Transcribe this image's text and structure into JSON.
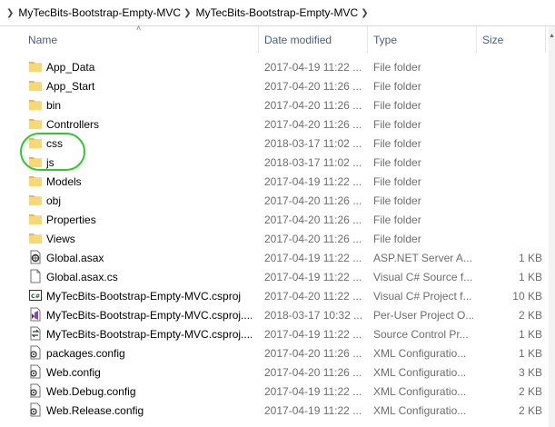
{
  "breadcrumb": [
    "MyTecBits-Bootstrap-Empty-MVC",
    "MyTecBits-Bootstrap-Empty-MVC"
  ],
  "columns": {
    "name": "Name",
    "date": "Date modified",
    "type": "Type",
    "size": "Size"
  },
  "rows": [
    {
      "name": "App_Data",
      "date": "2017-04-19 11:22 ...",
      "type": "File folder",
      "size": "",
      "icon": "folder-icon"
    },
    {
      "name": "App_Start",
      "date": "2017-04-20 11:26 ...",
      "type": "File folder",
      "size": "",
      "icon": "folder-icon"
    },
    {
      "name": "bin",
      "date": "2017-04-20 11:26 ...",
      "type": "File folder",
      "size": "",
      "icon": "folder-icon"
    },
    {
      "name": "Controllers",
      "date": "2017-04-20 11:26 ...",
      "type": "File folder",
      "size": "",
      "icon": "folder-icon"
    },
    {
      "name": "css",
      "date": "2018-03-17 11:02 ...",
      "type": "File folder",
      "size": "",
      "icon": "folder-icon"
    },
    {
      "name": "js",
      "date": "2018-03-17 11:02 ...",
      "type": "File folder",
      "size": "",
      "icon": "folder-icon"
    },
    {
      "name": "Models",
      "date": "2017-04-19 11:22 ...",
      "type": "File folder",
      "size": "",
      "icon": "folder-icon"
    },
    {
      "name": "obj",
      "date": "2017-04-20 11:26 ...",
      "type": "File folder",
      "size": "",
      "icon": "folder-icon"
    },
    {
      "name": "Properties",
      "date": "2017-04-20 11:26 ...",
      "type": "File folder",
      "size": "",
      "icon": "folder-icon"
    },
    {
      "name": "Views",
      "date": "2017-04-20 11:26 ...",
      "type": "File folder",
      "size": "",
      "icon": "folder-icon"
    },
    {
      "name": "Global.asax",
      "date": "2017-04-19 11:22 ...",
      "type": "ASP.NET Server A...",
      "size": "1 KB",
      "icon": "asax-file-icon"
    },
    {
      "name": "Global.asax.cs",
      "date": "2017-04-19 11:22 ...",
      "type": "Visual C# Source f...",
      "size": "1 KB",
      "icon": "file-icon"
    },
    {
      "name": "MyTecBits-Bootstrap-Empty-MVC.csproj",
      "date": "2017-04-20 11:22 ...",
      "type": "Visual C# Project f...",
      "size": "10 KB",
      "icon": "csproj-file-icon"
    },
    {
      "name": "MyTecBits-Bootstrap-Empty-MVC.csproj....",
      "date": "2018-03-17 10:32 ...",
      "type": "Per-User Project O...",
      "size": "2 KB",
      "icon": "vs-file-icon"
    },
    {
      "name": "MyTecBits-Bootstrap-Empty-MVC.csproj....",
      "date": "2017-04-19 11:22 ...",
      "type": "Source Control Pr...",
      "size": "1 KB",
      "icon": "source-control-file-icon"
    },
    {
      "name": "packages.config",
      "date": "2017-04-20 11:26 ...",
      "type": "XML Configuratio...",
      "size": "1 KB",
      "icon": "config-file-icon"
    },
    {
      "name": "Web.config",
      "date": "2017-04-20 11:26 ...",
      "type": "XML Configuratio...",
      "size": "3 KB",
      "icon": "config-file-icon"
    },
    {
      "name": "Web.Debug.config",
      "date": "2017-04-19 11:22 ...",
      "type": "XML Configuratio...",
      "size": "2 KB",
      "icon": "config-file-icon"
    },
    {
      "name": "Web.Release.config",
      "date": "2017-04-19 11:22 ...",
      "type": "XML Configuratio...",
      "size": "2 KB",
      "icon": "config-file-icon"
    }
  ],
  "colors": {
    "folder": "#f8d775",
    "highlight": "#2fc82f",
    "header_text": "#4c607a"
  }
}
